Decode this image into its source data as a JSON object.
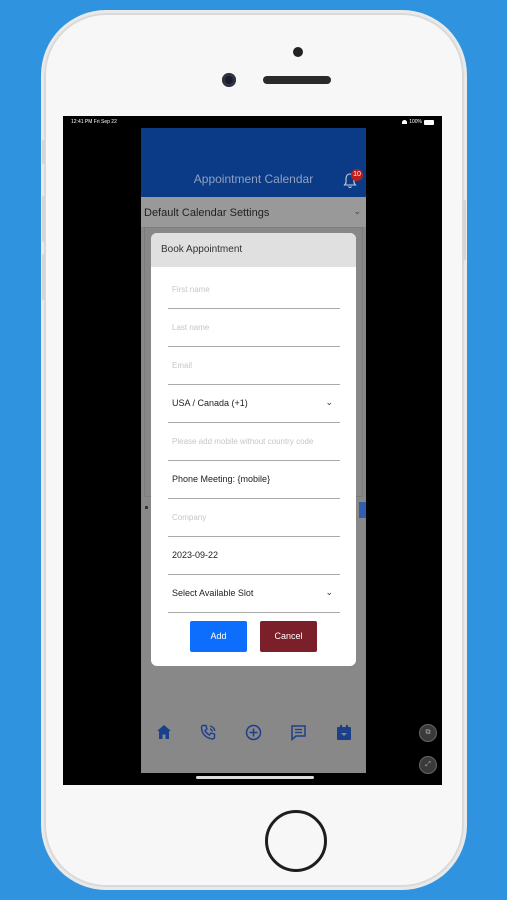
{
  "status_bar": {
    "time": "12:41 PM  Fri Sep 22",
    "battery": "100%"
  },
  "header": {
    "title": "Appointment Calendar",
    "notification_count": "10"
  },
  "settings": {
    "label": "Default Calendar Settings"
  },
  "modal": {
    "title": "Book Appointment",
    "fields": {
      "first_name": {
        "placeholder": "First name"
      },
      "last_name": {
        "placeholder": "Last name"
      },
      "email": {
        "placeholder": "Email"
      },
      "country": {
        "value": "USA / Canada (+1)"
      },
      "mobile": {
        "placeholder": "Please add mobile without country code"
      },
      "meeting_type": {
        "value": "Phone Meeting: {mobile}"
      },
      "company": {
        "placeholder": "Company"
      },
      "date": {
        "value": "2023-09-22"
      },
      "slot": {
        "value": "Select Available Slot"
      }
    },
    "buttons": {
      "add": "Add",
      "cancel": "Cancel"
    }
  },
  "bottom_nav": [
    "home-icon",
    "phone-call-icon",
    "add-circle-icon",
    "message-icon",
    "calendar-icon"
  ],
  "colors": {
    "header": "#0b3a86",
    "add": "#0d6efd",
    "cancel": "#7b1f2a",
    "background": "#2f93df"
  }
}
